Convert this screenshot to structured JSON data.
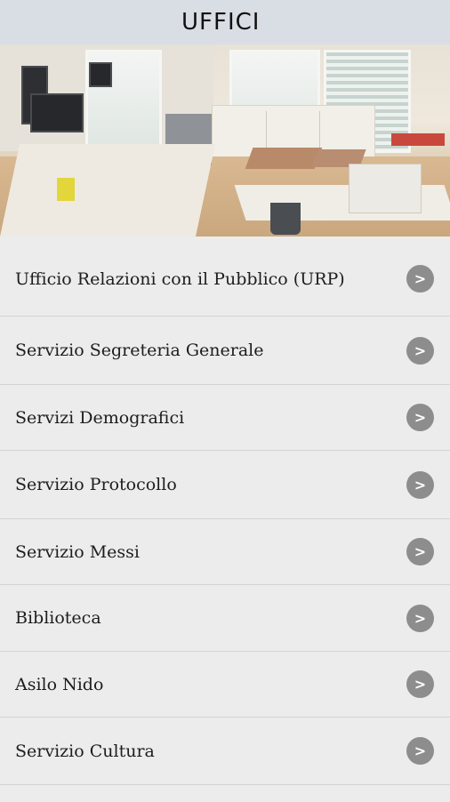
{
  "header": {
    "title": "UFFICI"
  },
  "hero": {
    "image": "office-photo"
  },
  "rows": [
    {
      "label": "Ufficio Relazioni con il Pubblico (URP)",
      "icon": "chevron-right-icon"
    },
    {
      "label": "Servizio Segreteria Generale",
      "icon": "chevron-right-icon"
    },
    {
      "label": "Servizi Demografici",
      "icon": "chevron-right-icon"
    },
    {
      "label": "Servizio Protocollo",
      "icon": "chevron-right-icon"
    },
    {
      "label": "Servizio Messi",
      "icon": "chevron-right-icon"
    },
    {
      "label": "Biblioteca",
      "icon": "chevron-right-icon"
    },
    {
      "label": "Asilo Nido",
      "icon": "chevron-right-icon"
    },
    {
      "label": "Servizio Cultura",
      "icon": "chevron-right-icon"
    }
  ],
  "arrow_glyph": ">"
}
